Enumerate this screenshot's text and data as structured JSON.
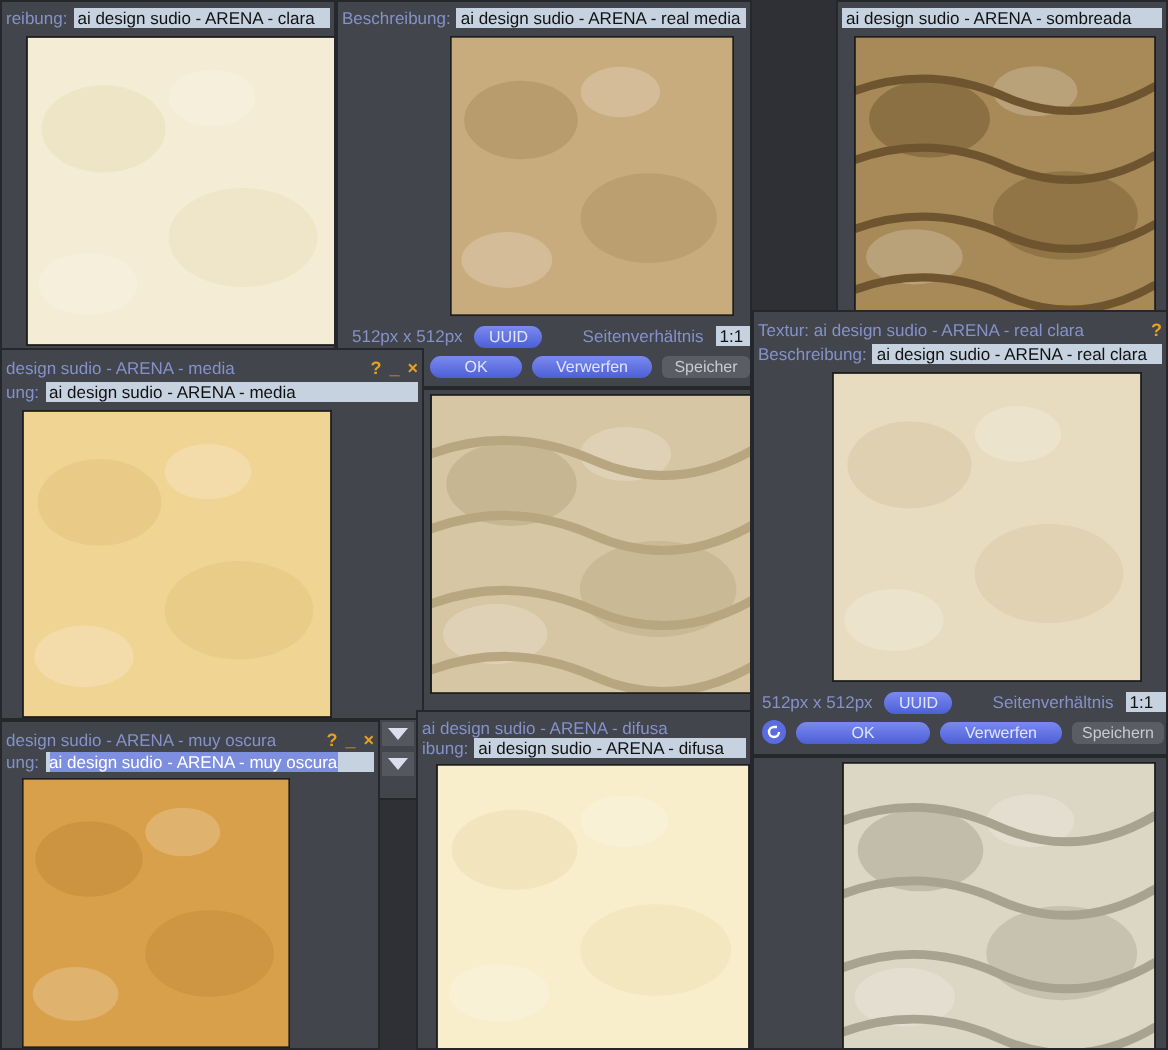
{
  "windows": [
    {
      "kind": "plain",
      "description_label": "reibung:",
      "description": "ai design sudio - ARENA - clara",
      "description_selected": false
    },
    {
      "kind": "plain",
      "description_label": "Beschreibung:",
      "description": "ai design sudio - ARENA - real media",
      "description_selected": false,
      "size": "512px x 512px",
      "uuid_button": "UUID",
      "aspect_label": "Seitenverhältnis",
      "aspect": "1:1",
      "buttons": [
        {
          "label": "OK",
          "kind": "primary"
        },
        {
          "label": "Verwerfen",
          "kind": "primary"
        },
        {
          "label": "Speicher",
          "kind": "plain"
        }
      ]
    },
    {
      "kind": "waves",
      "description": "ai design sudio - ARENA - sombreada",
      "description_selected": false
    },
    {
      "kind": "plain",
      "title": "design sudio - ARENA - media",
      "title_icons": [
        "?",
        "_",
        "×"
      ],
      "description_label": "ung:",
      "description": "ai design sudio - ARENA - media",
      "description_selected": false
    },
    {
      "kind": "waves",
      "scroll_buttons": true
    },
    {
      "kind": "plain",
      "title": "Textur: ai design sudio - ARENA - real clara",
      "title_icons": [
        "?"
      ],
      "description_label": "Beschreibung:",
      "description": "ai design sudio - ARENA - real clara",
      "description_selected": false,
      "size": "512px x 512px",
      "uuid_button": "UUID",
      "aspect_label": "Seitenverhältnis",
      "aspect": "1:1",
      "refresh": true,
      "buttons": [
        {
          "label": "OK",
          "kind": "primary"
        },
        {
          "label": "Verwerfen",
          "kind": "primary"
        },
        {
          "label": "Speichern",
          "kind": "plain"
        }
      ]
    },
    {
      "kind": "plain",
      "title": "design sudio - ARENA - muy oscura",
      "title_icons": [
        "?",
        "_",
        "×"
      ],
      "description_label": "ung:",
      "description": "ai design sudio - ARENA - muy oscura",
      "description_selected": true
    },
    {
      "kind": "plain",
      "title": "ai design sudio - ARENA - difusa",
      "description_label": "ibung:",
      "description": "ai design sudio - ARENA - difusa",
      "description_selected": false
    },
    {
      "kind": "waves"
    }
  ]
}
